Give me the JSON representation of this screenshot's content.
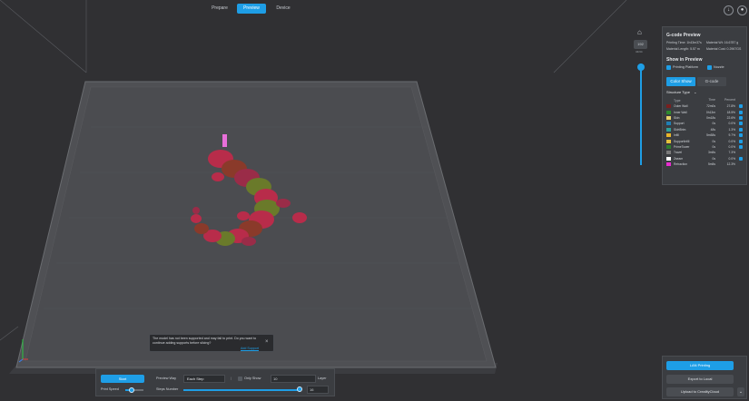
{
  "top_nav": {
    "tabs": [
      {
        "label": "Prepare"
      },
      {
        "label": "Preview"
      },
      {
        "label": "Device"
      }
    ],
    "active_tab": "Preview",
    "icons": [
      "download-icon",
      "user-icon"
    ]
  },
  "layer_slider": {
    "top_label": "192",
    "sub_label": "34/34",
    "icon": "home-icon"
  },
  "gcode_panel": {
    "title": "G-code Preview",
    "printing_time_label": "Printing Time: 1h43m37s",
    "material_wt_label": "Material Wt: 16.6787 g",
    "material_length_label": "Material Length: 5.57 m",
    "material_cost_label": "Material Cost: 0.2967GS",
    "show_in_preview_title": "Show in Preview",
    "checkboxes": [
      {
        "label": "Printing Platform",
        "checked": true
      },
      {
        "label": "Nozzle",
        "checked": true
      }
    ],
    "view_buttons": {
      "color_show": "Color Show",
      "gcode": "G-code"
    },
    "structure_type_label": "Structure Type",
    "table_headers": {
      "type": "Type",
      "time": "Time",
      "percent": "Percent"
    },
    "rows": [
      {
        "type": "Outer Wall",
        "time": "72m0s",
        "percent": "27.8%",
        "color": "#7a1f1f",
        "checked": true
      },
      {
        "type": "Inner Wall",
        "time": "0h13m",
        "percent": "18.5%",
        "color": "#2e8a2e",
        "checked": true
      },
      {
        "type": "Skin",
        "time": "0m18s",
        "percent": "22.6%",
        "color": "#e7d36a",
        "checked": true
      },
      {
        "type": "Support",
        "time": "0s",
        "percent": "0.0%",
        "color": "#1f7fb5",
        "checked": true
      },
      {
        "type": "SkirtBrim",
        "time": "48s",
        "percent": "1.3%",
        "color": "#2f9f9a",
        "checked": true
      },
      {
        "type": "Infill",
        "time": "5m58s",
        "percent": "9.7%",
        "color": "#e8b52a",
        "checked": true
      },
      {
        "type": "SupportInfill",
        "time": "0s",
        "percent": "0.0%",
        "color": "#e6c13b",
        "checked": true
      },
      {
        "type": "PrimeTower",
        "time": "0s",
        "percent": "0.0%",
        "color": "#2d7d2d",
        "checked": true
      },
      {
        "type": "Travel",
        "time": "3m5s",
        "percent": "7.3%",
        "color": "#7a7a7a",
        "checked": false
      },
      {
        "type": "Zseam",
        "time": "0s",
        "percent": "0.0%",
        "color": "#ffffff",
        "checked": true
      },
      {
        "type": "Retraction",
        "time": "5m5s",
        "percent": "12.3%",
        "color": "#e82bd0",
        "checked": false
      }
    ]
  },
  "bottom_actions": {
    "lan_printing": "LAN Printing",
    "export_to_local": "Export to Local",
    "upload_to_cloud": "Upload to CrealityCloud",
    "more": "⌄"
  },
  "bottom_controls": {
    "start": "Start",
    "preview_way_label": "Preview Way",
    "preview_way_value": "Each Step",
    "only_show_label": "Only Show",
    "only_show_value": "10",
    "layer_label": "Layer",
    "print_speed_label": "Print Speed",
    "steps_number_label": "Steps Number",
    "steps_number_value": "16"
  },
  "tooltip": {
    "text": "The model has not been supported and may fail to print. Do you want to continue adding supports before slicing?",
    "link": "Add Support",
    "close": "×"
  },
  "colors": {
    "accent": "#1e9ee6",
    "background": "#303033",
    "panel": "#3b3d41"
  }
}
